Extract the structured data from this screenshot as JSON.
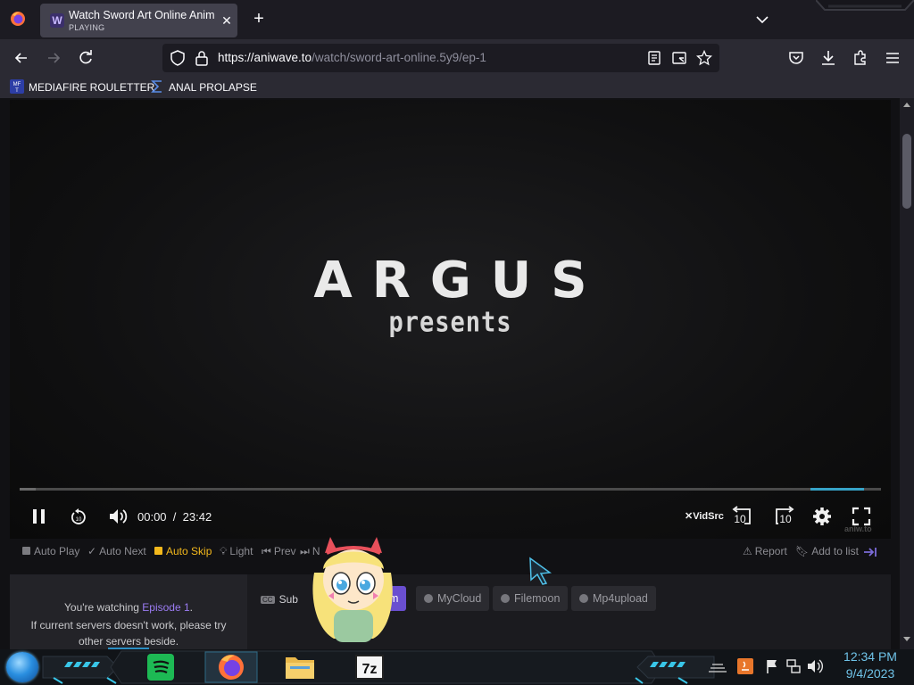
{
  "browser": {
    "tab": {
      "title": "Watch Sword Art Online Anime",
      "status": "PLAYING",
      "favicon_letter": "W"
    },
    "url": {
      "host": "https://aniwave.to",
      "path": "/watch/sword-art-online.5y9/ep-1"
    },
    "bookmarks": [
      {
        "label": "MEDIAFIRE ROULETTER",
        "icon_text": "MF T"
      },
      {
        "label": "ANAL PROLAPSE",
        "icon": "sigma-icon"
      }
    ]
  },
  "player": {
    "title_card": {
      "main": "ARGUS",
      "sub": "presents"
    },
    "current_time": "00:00",
    "separator": "/",
    "duration": "23:42",
    "progress_fraction": 0.0,
    "provider": "VidSrc",
    "rewind_label": "10",
    "forward_label": "10",
    "watermark": "aniw.to"
  },
  "options": {
    "auto_play": "Auto Play",
    "auto_next": "Auto Next",
    "auto_skip": "Auto Skip",
    "light": "Light",
    "prev": "Prev",
    "next": "N",
    "report": "Report",
    "add_to_list": "Add to list"
  },
  "servers": {
    "watching_prefix": "You're watching",
    "episode": "Episode 1",
    "watching_suffix": ".",
    "hint": "If current servers doesn't work, please try other servers beside.",
    "sub_label": "Sub",
    "active_server": "m",
    "list": [
      "MyCloud",
      "Filemoon",
      "Mp4upload"
    ]
  },
  "taskbar": {
    "time": "12:34 PM",
    "date": "9/4/2023",
    "apps": [
      "spotify-icon",
      "firefox-icon",
      "file-explorer-icon",
      "7zip-icon"
    ],
    "seven_zip_text": "7z"
  },
  "colors": {
    "accent_yellow": "#f3b81c",
    "accent_purple": "#6a4fd0",
    "episode_purple": "#9b7cf3",
    "clock_blue": "#6fc3e8"
  }
}
